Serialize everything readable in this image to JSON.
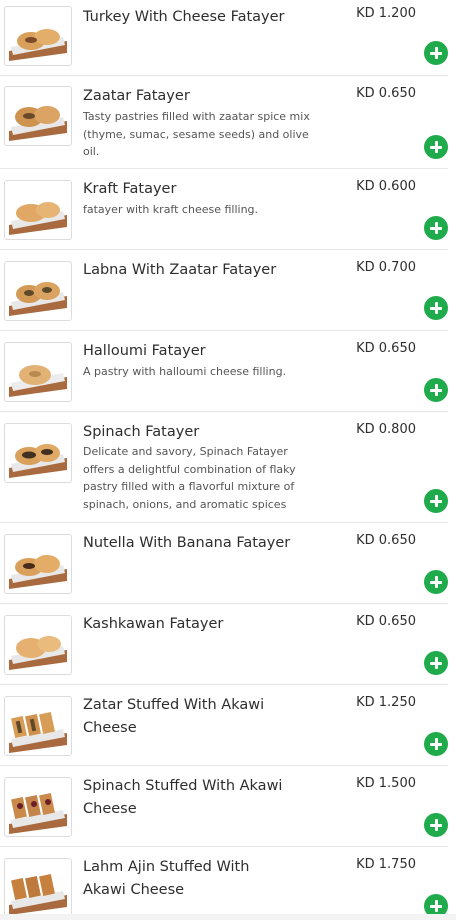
{
  "items": [
    {
      "name": "Turkey With Cheese Fatayer",
      "description": "",
      "price": "KD 1.200",
      "image": "fatayer-plate"
    },
    {
      "name": "Zaatar Fatayer",
      "description": "Tasty pastries filled with zaatar spice mix (thyme, sumac, sesame seeds) and olive oil.",
      "price": "KD 0.650",
      "image": "fatayer-plate"
    },
    {
      "name": "Kraft Fatayer",
      "description": "fatayer with kraft cheese filling.",
      "price": "KD 0.600",
      "image": "fatayer-plate"
    },
    {
      "name": "Labna With Zaatar Fatayer",
      "description": "",
      "price": "KD 0.700",
      "image": "fatayer-plate"
    },
    {
      "name": "Halloumi Fatayer",
      "description": "A pastry with halloumi cheese filling.",
      "price": "KD 0.650",
      "image": "fatayer-plate"
    },
    {
      "name": "Spinach Fatayer",
      "description": "Delicate and savory, Spinach Fatayer offers a delightful combination of flaky pastry filled with a flavorful mixture of spinach, onions, and aromatic spices",
      "price": "KD 0.800",
      "image": "fatayer-plate"
    },
    {
      "name": "Nutella With Banana Fatayer",
      "description": "",
      "price": "KD 0.650",
      "image": "fatayer-plate"
    },
    {
      "name": "Kashkawan Fatayer",
      "description": "",
      "price": "KD 0.650",
      "image": "fatayer-plate"
    },
    {
      "name": "Zatar Stuffed With Akawi Cheese",
      "description": "",
      "price": "KD 1.250",
      "image": "stuffed-bread-plate"
    },
    {
      "name": "Spinach Stuffed With Akawi Cheese",
      "description": "",
      "price": "KD 1.500",
      "image": "stuffed-bread-plate"
    },
    {
      "name": "Lahm Ajin Stuffed With Akawi Cheese",
      "description": "",
      "price": "KD 1.750",
      "image": "stuffed-bread-plate"
    }
  ],
  "add_button_icon": "plus-icon",
  "colors": {
    "accent_green": "#1faa4b",
    "divider": "#e6e6e6"
  }
}
